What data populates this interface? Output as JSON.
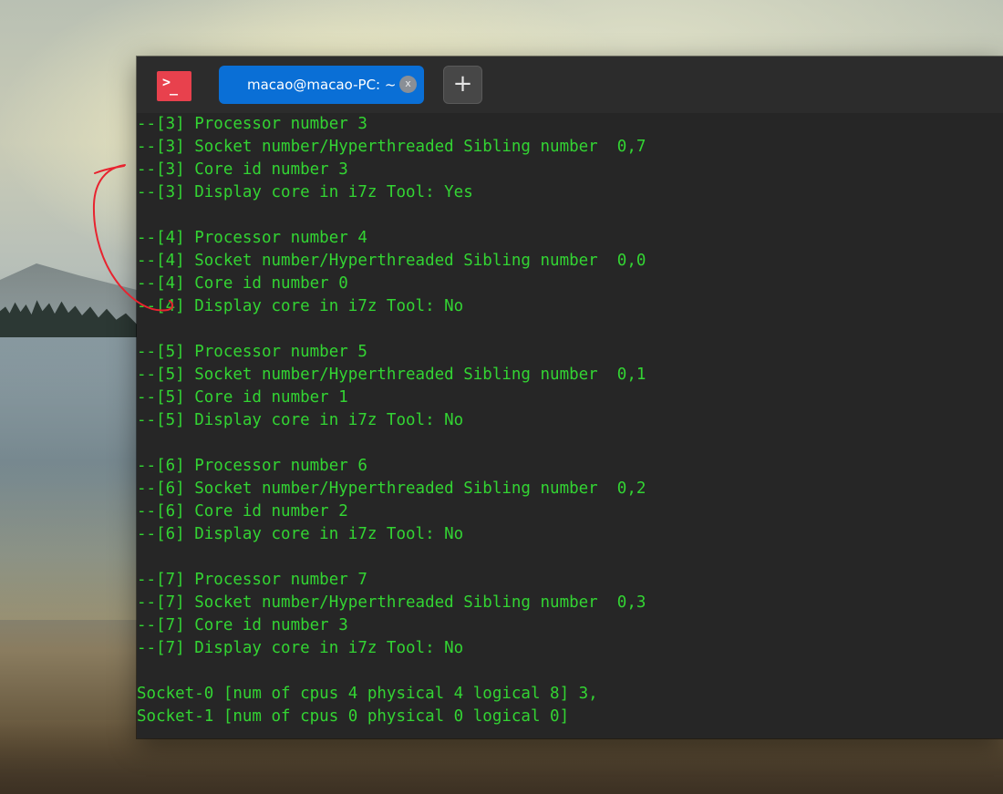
{
  "terminal": {
    "tab_title": "macao@macao-PC: ~",
    "tab_close_glyph": "x",
    "new_tab_glyph": "+",
    "app_icon_glyph_top": ">",
    "app_icon_glyph_bottom": "_",
    "text_color": "#33d433",
    "lines": [
      "--[3] Processor number 3",
      "--[3] Socket number/Hyperthreaded Sibling number  0,7",
      "--[3] Core id number 3",
      "--[3] Display core in i7z Tool: Yes",
      "",
      "--[4] Processor number 4",
      "--[4] Socket number/Hyperthreaded Sibling number  0,0",
      "--[4] Core id number 0",
      "--[4] Display core in i7z Tool: No",
      "",
      "--[5] Processor number 5",
      "--[5] Socket number/Hyperthreaded Sibling number  0,1",
      "--[5] Core id number 1",
      "--[5] Display core in i7z Tool: No",
      "",
      "--[6] Processor number 6",
      "--[6] Socket number/Hyperthreaded Sibling number  0,2",
      "--[6] Core id number 2",
      "--[6] Display core in i7z Tool: No",
      "",
      "--[7] Processor number 7",
      "--[7] Socket number/Hyperthreaded Sibling number  0,3",
      "--[7] Core id number 3",
      "--[7] Display core in i7z Tool: No",
      "",
      "Socket-0 [num of cpus 4 physical 4 logical 8] 3,",
      "Socket-1 [num of cpus 0 physical 0 logical 0]"
    ]
  },
  "colors": {
    "tab_active": "#0a6fd6",
    "app_icon": "#e8414d",
    "terminal_bg": "#262626",
    "annotation_stroke": "#e8232f"
  }
}
